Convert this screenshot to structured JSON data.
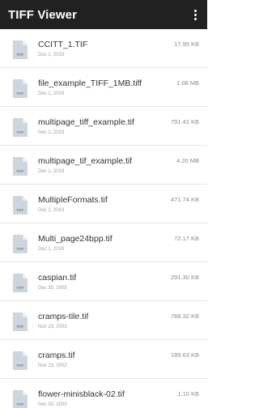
{
  "app": {
    "title": "TIFF Viewer",
    "icons": {
      "overflow_menu": "more-vert-icon",
      "file": "tiff-file-icon"
    }
  },
  "colors": {
    "appbar_bg": "#212121",
    "file_icon": "#cfd5de",
    "file_icon_fold": "#e9edf2"
  },
  "files": [
    {
      "name": "CCITT_1.TIF",
      "date": "Dec 1, 2019",
      "size": "17.95 KB",
      "icon_label": "TIFF"
    },
    {
      "name": "file_example_TIFF_1MB.tiff",
      "date": "Dec 1, 2019",
      "size": "1.08 MB",
      "icon_label": "TIFF"
    },
    {
      "name": "multipage_tiff_example.tif",
      "date": "Dec 1, 2019",
      "size": "791.41 KB",
      "icon_label": "TIFF"
    },
    {
      "name": "multipage_tif_example.tif",
      "date": "Dec 1, 2019",
      "size": "4.20 MB",
      "icon_label": "TIFF"
    },
    {
      "name": "MultipleFormats.tif",
      "date": "Dec 1, 2019",
      "size": "471.74 KB",
      "icon_label": "TIFF"
    },
    {
      "name": "Multi_page24bpp.tif",
      "date": "Dec 1, 2019",
      "size": "72.17 KB",
      "icon_label": "TIFF"
    },
    {
      "name": "caspian.tif",
      "date": "Dec 30, 2005",
      "size": "291.30 KB",
      "icon_label": "TIFF"
    },
    {
      "name": "cramps-tile.tif",
      "date": "Nov 23, 2002",
      "size": "768.32 KB",
      "icon_label": "TIFF"
    },
    {
      "name": "cramps.tif",
      "date": "Nov 23, 2002",
      "size": "189.63 KB",
      "icon_label": "TIFF"
    },
    {
      "name": "flower-minisblack-02.tif",
      "date": "Dec 30, 2005",
      "size": "1.10 KB",
      "icon_label": "TIFF"
    }
  ]
}
